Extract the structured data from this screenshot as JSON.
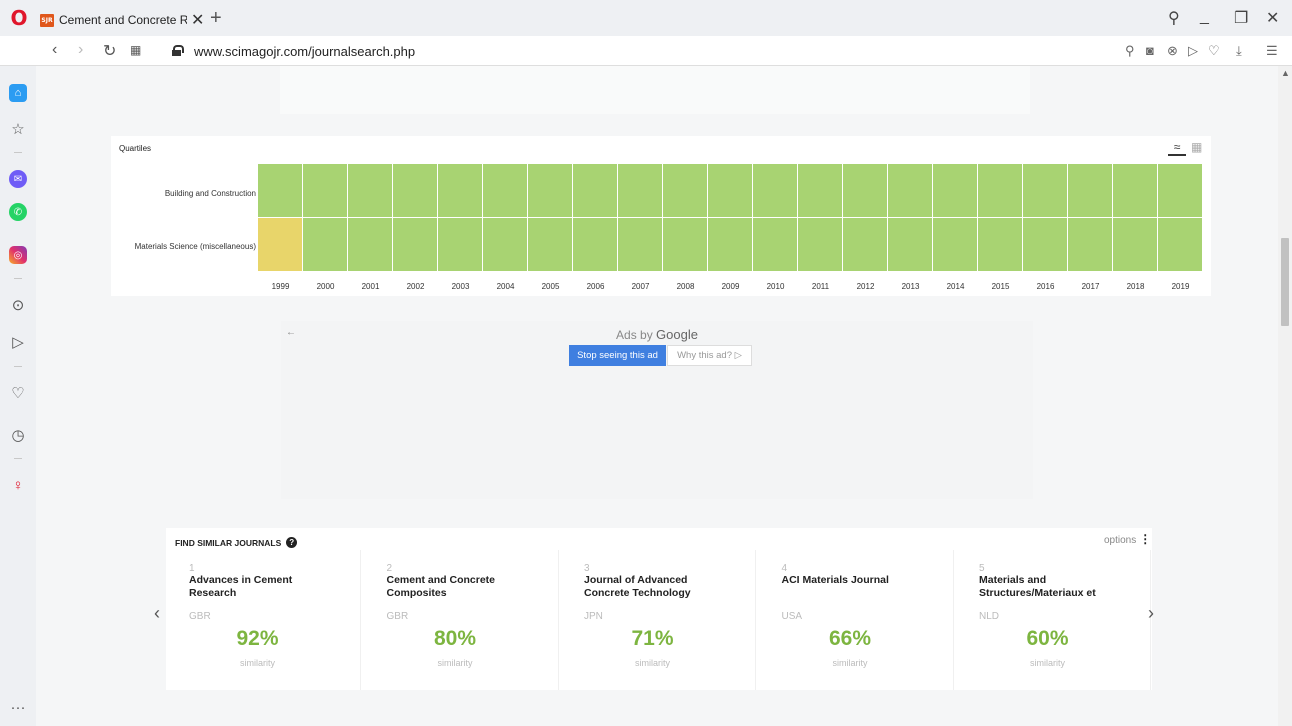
{
  "browser": {
    "tab_title": "Cement and Concrete Rese",
    "favicon_text": "SJR",
    "close_glyph": "✕",
    "new_tab_glyph": "+",
    "url": "www.scimagojr.com/journalsearch.php"
  },
  "quartiles": {
    "title": "Quartiles",
    "rows": [
      {
        "label": "Building and Construction",
        "quartiles": [
          "Q1",
          "Q1",
          "Q1",
          "Q1",
          "Q1",
          "Q1",
          "Q1",
          "Q1",
          "Q1",
          "Q1",
          "Q1",
          "Q1",
          "Q1",
          "Q1",
          "Q1",
          "Q1",
          "Q1",
          "Q1",
          "Q1",
          "Q1",
          "Q1"
        ]
      },
      {
        "label": "Materials Science (miscellaneous)",
        "quartiles": [
          "Q2",
          "Q1",
          "Q1",
          "Q1",
          "Q1",
          "Q1",
          "Q1",
          "Q1",
          "Q1",
          "Q1",
          "Q1",
          "Q1",
          "Q1",
          "Q1",
          "Q1",
          "Q1",
          "Q1",
          "Q1",
          "Q1",
          "Q1",
          "Q1"
        ]
      }
    ],
    "years": [
      "1999",
      "2000",
      "2001",
      "2002",
      "2003",
      "2004",
      "2005",
      "2006",
      "2007",
      "2008",
      "2009",
      "2010",
      "2011",
      "2012",
      "2013",
      "2014",
      "2015",
      "2016",
      "2017",
      "2018",
      "2019"
    ],
    "colors": {
      "Q1": "#a8d372",
      "Q2": "#e8d56a"
    }
  },
  "ad": {
    "title_prefix": "Ads by ",
    "title_brand": "Google",
    "stop_label": "Stop seeing this ad",
    "why_label": "Why this ad? ▷"
  },
  "similar": {
    "title": "FIND SIMILAR JOURNALS",
    "options_label": "options",
    "similarity_label": "similarity",
    "journals": [
      {
        "rank": "1",
        "name": "Advances in Cement Research",
        "country": "GBR",
        "percent": "92%"
      },
      {
        "rank": "2",
        "name": "Cement and Concrete Composites",
        "country": "GBR",
        "percent": "80%"
      },
      {
        "rank": "3",
        "name": "Journal of Advanced Concrete Technology",
        "country": "JPN",
        "percent": "71%"
      },
      {
        "rank": "4",
        "name": "ACI Materials Journal",
        "country": "USA",
        "percent": "66%"
      },
      {
        "rank": "5",
        "name": "Materials and Structures/Materiaux et",
        "country": "NLD",
        "percent": "60%"
      }
    ]
  }
}
